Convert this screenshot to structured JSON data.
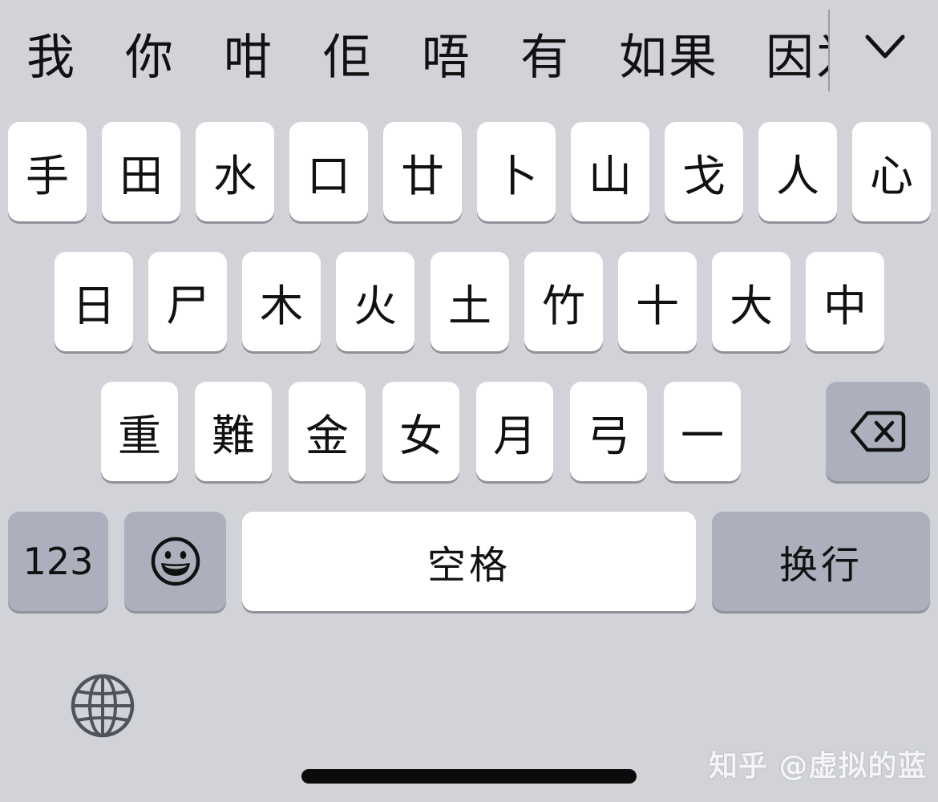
{
  "candidates": [
    "我",
    "你",
    "咁",
    "佢",
    "唔",
    "有",
    "如果",
    "因为"
  ],
  "keyboard": {
    "row1": [
      "手",
      "田",
      "水",
      "口",
      "廿",
      "卜",
      "山",
      "戈",
      "人",
      "心"
    ],
    "row2": [
      "日",
      "尸",
      "木",
      "火",
      "土",
      "竹",
      "十",
      "大",
      "中"
    ],
    "row3": [
      "重",
      "難",
      "金",
      "女",
      "月",
      "弓",
      "一"
    ],
    "numbers_label": "123",
    "space_label": "空格",
    "return_label": "换行"
  },
  "icons": {
    "expand": "chevron-down-icon",
    "backspace": "backspace-icon",
    "emoji": "emoji-icon",
    "globe": "globe-icon"
  },
  "watermark": "知乎 @虚拟的蓝",
  "colors": {
    "keyboard_bg": "#d1d3d9",
    "key_bg": "#ffffff",
    "dark_key_bg": "#abb0bc",
    "key_shadow": "#8f9197"
  }
}
